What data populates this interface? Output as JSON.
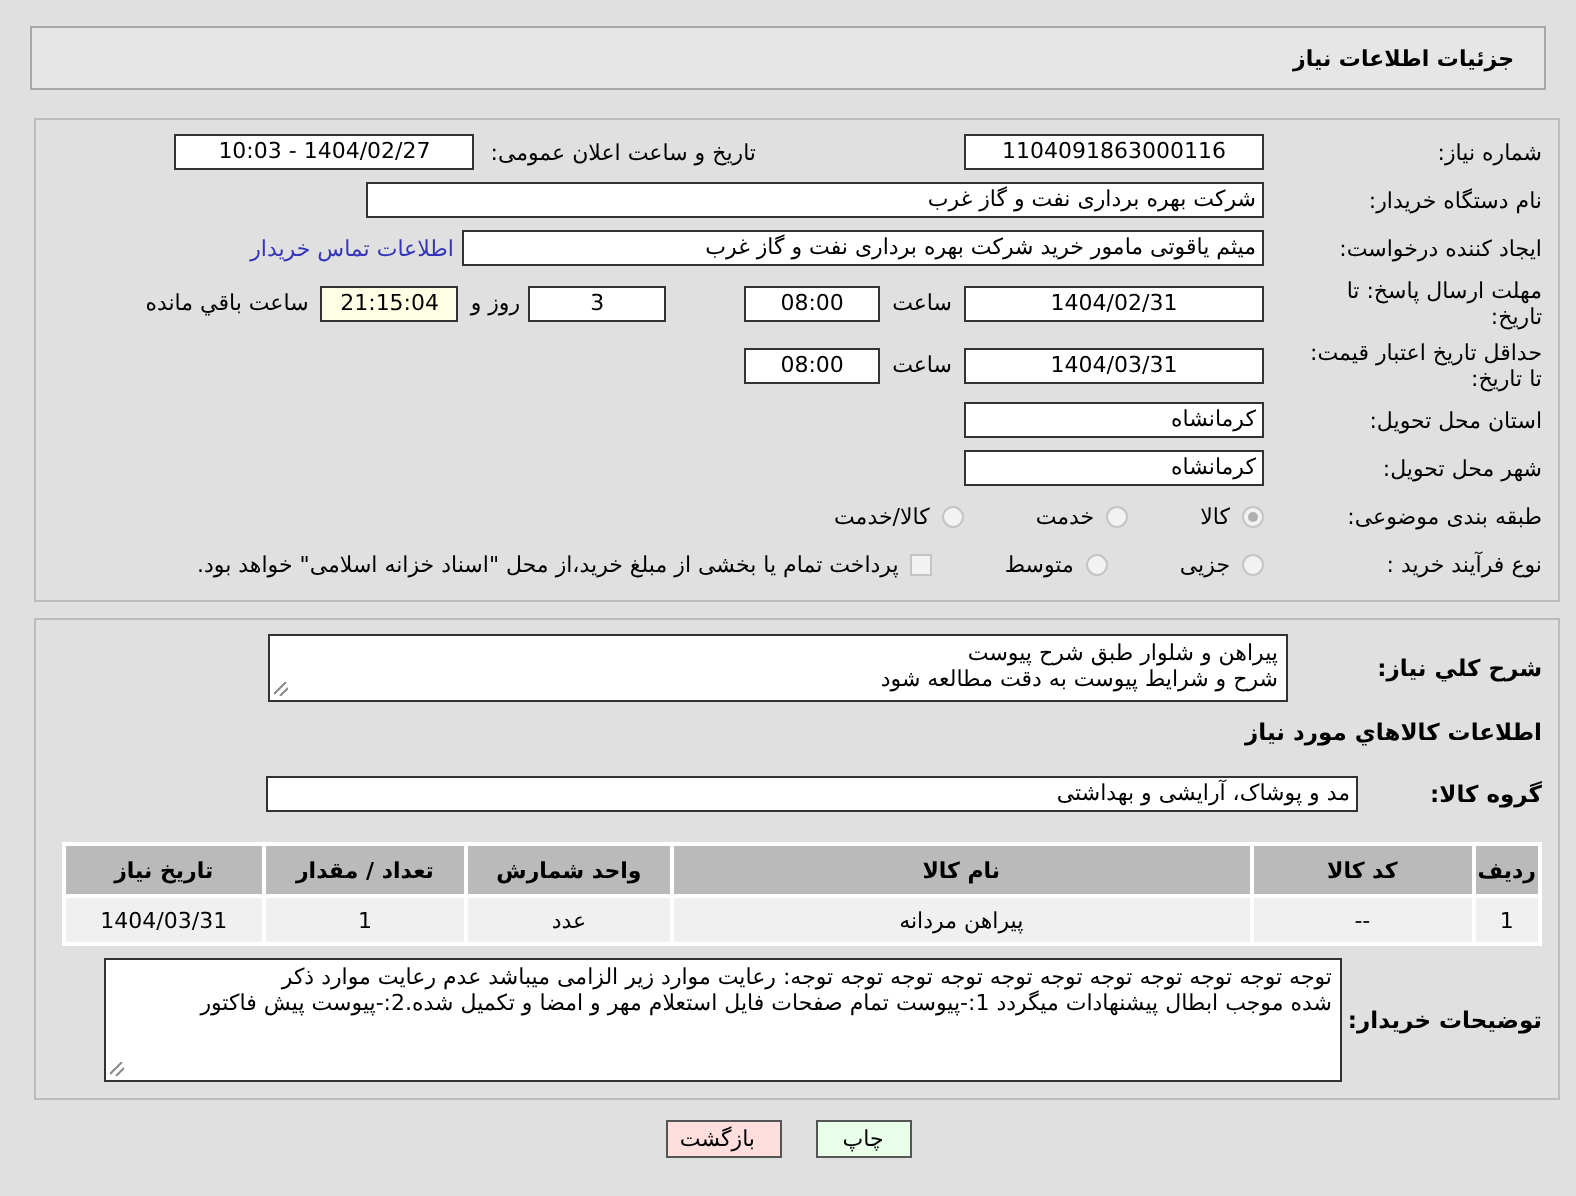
{
  "title": "جزئیات اطلاعات نیاز",
  "need_number": {
    "label": "شماره نیاز:",
    "value": "1104091863000116"
  },
  "announce": {
    "label": "تاریخ و ساعت اعلان عمومی:",
    "value": "1404/02/27 - 10:03"
  },
  "buyer_org": {
    "label": "نام دستگاه خریدار:",
    "value": "شرکت بهره برداری نفت و گاز غرب"
  },
  "requester": {
    "label": "ایجاد کننده درخواست:",
    "value": "میثم یاقوتی مامور خرید شرکت بهره برداری نفت و گاز غرب",
    "link": "اطلاعات تماس خریدار"
  },
  "deadline": {
    "label": "مهلت ارسال پاسخ: تا تاریخ:",
    "date": "1404/02/31",
    "time_label": "ساعت",
    "time": "08:00",
    "days": "3",
    "days_label": "روز و",
    "remaining": "21:15:04",
    "remaining_label": "ساعت باقي مانده"
  },
  "validity": {
    "label": "حداقل تاریخ اعتبار قیمت: تا تاریخ:",
    "date": "1404/03/31",
    "time_label": "ساعت",
    "time": "08:00"
  },
  "province": {
    "label": "استان محل تحویل:",
    "value": "کرمانشاه"
  },
  "city": {
    "label": "شهر محل تحویل:",
    "value": "کرمانشاه"
  },
  "category": {
    "label": "طبقه بندی موضوعی:",
    "options": [
      {
        "label": "کالا",
        "selected": true
      },
      {
        "label": "خدمت",
        "selected": false
      },
      {
        "label": "کالا/خدمت",
        "selected": false
      }
    ]
  },
  "process": {
    "label": "نوع فرآیند خرید :",
    "options": [
      {
        "label": "جزیی",
        "selected": false
      },
      {
        "label": "متوسط",
        "selected": false
      }
    ],
    "payment": {
      "label": "پرداخت تمام یا بخشی از مبلغ خرید،از محل \"اسناد خزانه اسلامی\" خواهد بود.",
      "checked": false
    }
  },
  "description": {
    "label": "شرح کلي نیاز:",
    "value": "پیراهن و شلوار طبق شرح پیوست\nشرح و شرایط پیوست به دقت مطالعه شود"
  },
  "goods_heading": "اطلاعات کالاهاي مورد نیاز",
  "goods_group": {
    "label": "گروه کالا:",
    "value": "مد و پوشاک، آرایشی و بهداشتی"
  },
  "table": {
    "columns": [
      "ردیف",
      "کد کالا",
      "نام کالا",
      "واحد شمارش",
      "تعداد / مقدار",
      "تاریخ نیاز"
    ],
    "rows": [
      [
        "1",
        "--",
        "پیراهن مردانه",
        "عدد",
        "1",
        "1404/03/31"
      ]
    ]
  },
  "buyer_notes": {
    "label": "توضیحات خریدار:",
    "value": "توجه توجه توجه توجه توجه توجه توجه توجه توجه توجه توجه: رعایت موارد زیر الزامی میباشد عدم رعایت موارد ذکر\nشده موجب ابطال پیشنهادات میگردد 1:-پیوست تمام صفحات  فایل استعلام مهر و امضا و تکمیل شده.2:-پیوست پیش فاکتور"
  },
  "buttons": [
    {
      "label": "چاپ",
      "kind": "print"
    },
    {
      "label": "بازگشت",
      "kind": "back"
    }
  ]
}
